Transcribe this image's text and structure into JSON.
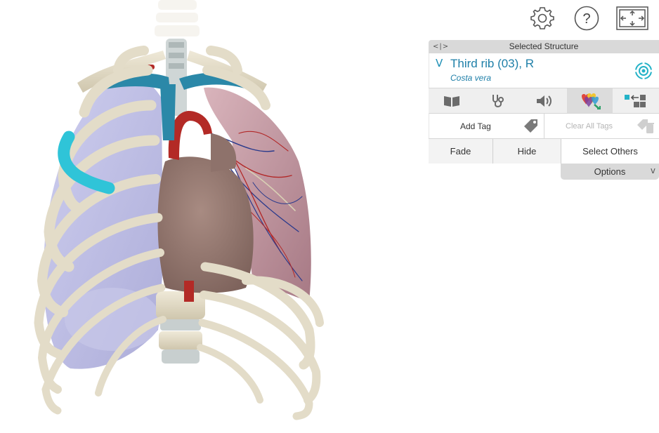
{
  "toolbar": {
    "settings_icon": "gear-icon",
    "help_icon": "question-icon",
    "help_glyph": "?",
    "fullscreen_icon": "fullscreen-icon"
  },
  "panel": {
    "header_title": "Selected Structure",
    "collapse_glyph": "<|>",
    "structure": {
      "name": "Third rib (03), R",
      "latin": "Costa vera",
      "expand_glyph": "V"
    },
    "tabs": [
      {
        "icon": "book-icon"
      },
      {
        "icon": "stethoscope-icon"
      },
      {
        "icon": "speaker-icon"
      },
      {
        "icon": "quiz-icon",
        "active": true
      },
      {
        "icon": "isolate-icon"
      }
    ],
    "add_tag_label": "Add Tag",
    "clear_tags_label": "Clear All Tags",
    "fade_label": "Fade",
    "hide_label": "Hide",
    "select_others_label": "Select Others",
    "options_label": "Options",
    "options_chevron": "v"
  },
  "colors": {
    "accent": "#1e7fa8",
    "selected_rib": "#2fc4d8",
    "rib_bone": "#e3dcc8",
    "lung_right": "#b3b3e0",
    "lung_left": "#b98a96",
    "heart": "#9c7f76",
    "aorta": "#b32a26",
    "vena": "#2b88a8"
  }
}
